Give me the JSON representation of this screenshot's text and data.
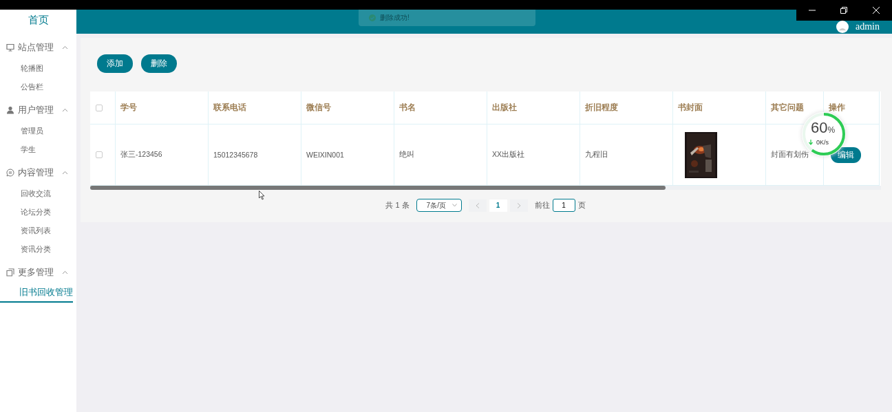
{
  "sidebar": {
    "home": "首页",
    "groups": [
      {
        "label": "站点管理",
        "expanded": true,
        "items": [
          {
            "label": "轮播图",
            "selected": false
          },
          {
            "label": "公告栏",
            "selected": false
          }
        ]
      },
      {
        "label": "用户管理",
        "expanded": true,
        "items": [
          {
            "label": "管理员",
            "selected": false
          },
          {
            "label": "学生",
            "selected": false
          }
        ]
      },
      {
        "label": "内容管理",
        "expanded": true,
        "items": [
          {
            "label": "回收交流",
            "selected": false
          },
          {
            "label": "论坛分类",
            "selected": false
          },
          {
            "label": "资讯列表",
            "selected": false
          },
          {
            "label": "资讯分类",
            "selected": false
          }
        ]
      },
      {
        "label": "更多管理",
        "expanded": true,
        "items": [
          {
            "label": "旧书回收管理",
            "selected": true
          }
        ]
      }
    ]
  },
  "header": {
    "toast": "删除成功!",
    "user": "admin"
  },
  "toolbar": [
    "添加",
    "删除"
  ],
  "table": {
    "header_checked": false,
    "columns": [
      "学号",
      "联系电话",
      "微信号",
      "书名",
      "出版社",
      "折旧程度",
      "书封面",
      "其它问题",
      "操作"
    ],
    "rows": [
      {
        "checked": false,
        "cells": [
          {
            "kind": "text",
            "text": "张三-123456"
          },
          {
            "kind": "text",
            "text": "15012345678"
          },
          {
            "kind": "text",
            "text": "WEIXIN001"
          },
          {
            "kind": "text",
            "text": "绝叫"
          },
          {
            "kind": "text",
            "text": "XX出版社"
          },
          {
            "kind": "text",
            "text": "九程旧"
          },
          {
            "kind": "picture"
          },
          {
            "kind": "text",
            "text": "封面有划伤"
          },
          {
            "kind": "button",
            "text": "编辑"
          }
        ]
      }
    ]
  },
  "pagination": {
    "total": "共 1 条",
    "page_size": "7条/页",
    "pages": [
      {
        "label": "1",
        "selected": true
      }
    ],
    "goto_label": "前往",
    "goto_value": "1",
    "page_suffix": "页"
  },
  "net_meter": {
    "percent": "60",
    "unit": "%",
    "speed": "0K/s",
    "level": 0.6
  }
}
